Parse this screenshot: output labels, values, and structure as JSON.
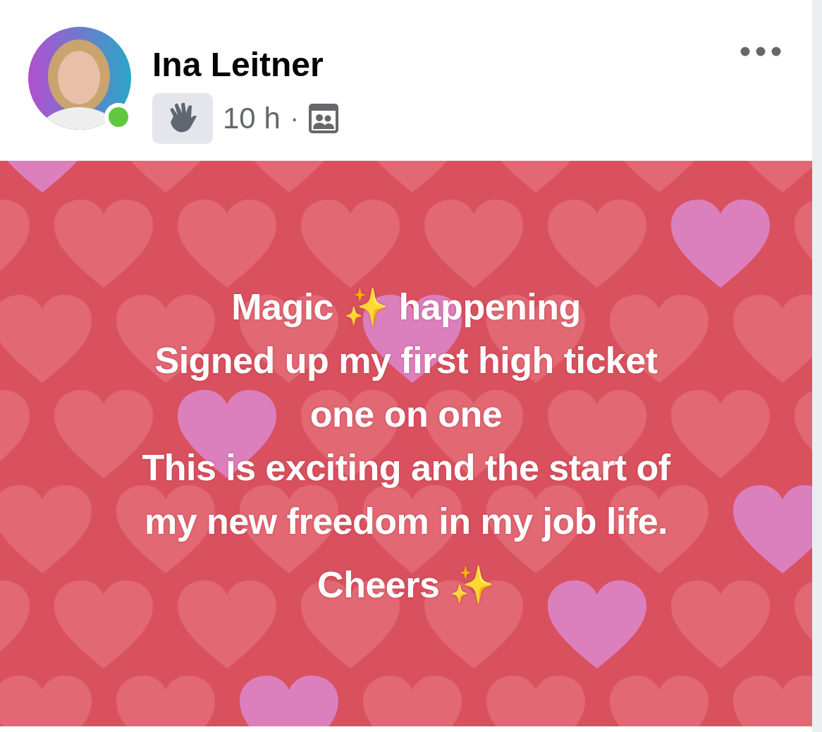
{
  "post": {
    "author": {
      "name": "Ina Leitner",
      "online": true
    },
    "meta": {
      "time": "10 h",
      "separator": "·"
    },
    "text_lines": [
      "Magic ✨ happening",
      "Signed up my first high ticket",
      "one on one",
      "This is exciting and the start of",
      "my new freedom in my job life.",
      "Cheers ✨"
    ]
  }
}
